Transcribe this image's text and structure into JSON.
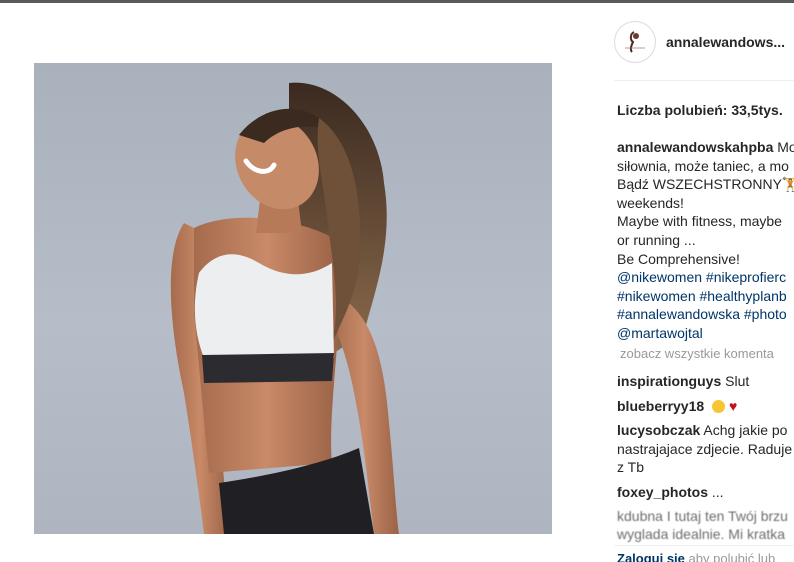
{
  "post": {
    "username": "annalewandows...",
    "likes": "Liczba polubień: 33,5tys.",
    "caption": {
      "author": "annalewandowskahpba",
      "first_text": "Mo",
      "lines": [
        "siłownia, może taniec, a mo",
        "Bądź WSZECHSTRONNY🏋",
        "weekends!",
        "Maybe with fitness, maybe",
        "or running ...",
        "Be Comprehensive!"
      ],
      "tag_lines": [
        "@nikewomen #nikeprofierc",
        "#nikewomen #healthyplanb",
        "#annalewandowska #photo",
        "@martawojtal"
      ]
    },
    "view_all": "zobacz wszystkie komenta",
    "comments": [
      {
        "user": "inspirationguys",
        "text": "Slut"
      },
      {
        "user": "blueberryy18",
        "text": ""
      },
      {
        "user": "lucysobczak",
        "text": "Achg jakie po",
        "more": [
          "nastrajajace zdjecie. Raduje",
          "z Tb"
        ]
      },
      {
        "user": "foxey_photos",
        "text": "..."
      }
    ],
    "blurred_comment": "kdubna I tutaj ten Twój brzu",
    "blurred_comment_2": "wyglada idealnie. Mi kratka",
    "login": {
      "link": "Zaloguj się",
      "rest": "aby polubić lub"
    }
  },
  "colors": {
    "link": "#003569",
    "muted": "#999999",
    "heart": "#c1121f"
  },
  "icons": {
    "avatar": "healthy-plan-logo-icon",
    "emoji": "smiling-face-icon",
    "heart": "heart-icon"
  }
}
